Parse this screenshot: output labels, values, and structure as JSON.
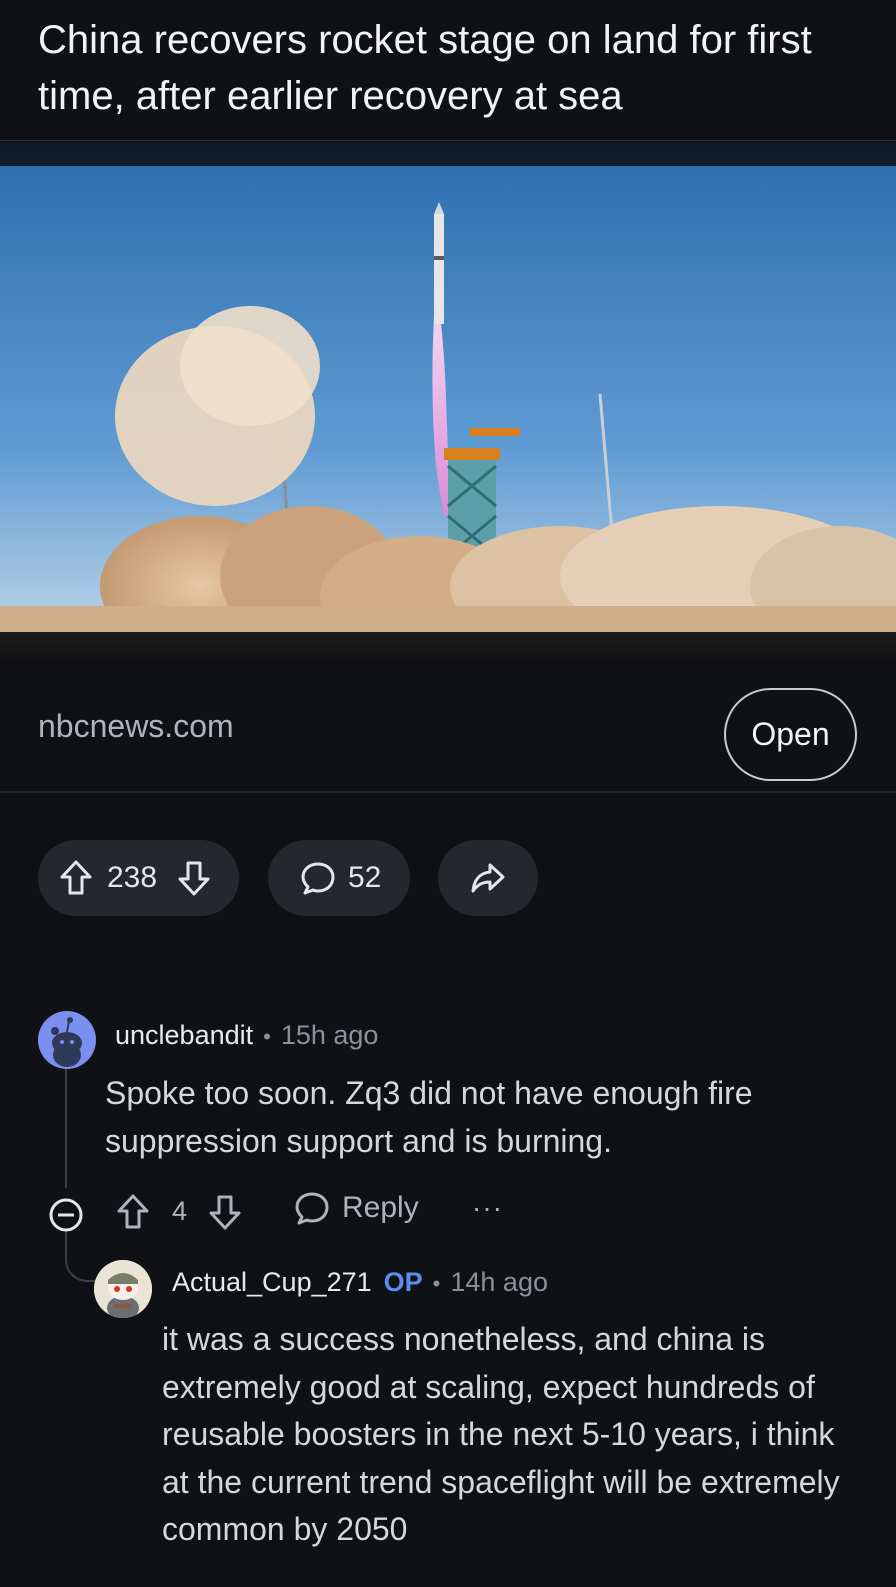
{
  "post": {
    "title": "China recovers rocket stage on land for first time, after earlier recovery at sea",
    "domain": "nbcnews.com",
    "open_label": "Open",
    "score": "238",
    "comment_count": "52"
  },
  "comments": [
    {
      "username": "unclebandit",
      "time": "15h ago",
      "body": "Spoke too soon. Zq3 did not have enough fire suppression support and is burning.",
      "score": "4",
      "reply_label": "Reply",
      "more_label": "···"
    },
    {
      "username": "Actual_Cup_271",
      "op_label": "OP",
      "time": "14h ago",
      "body": "it was a success nonetheless, and china is extremely good at scaling, expect hundreds of reusable boosters in the next 5-10 years, i think at the current trend spaceflight will be extremely common by 2050"
    }
  ],
  "meta_separator": "•"
}
